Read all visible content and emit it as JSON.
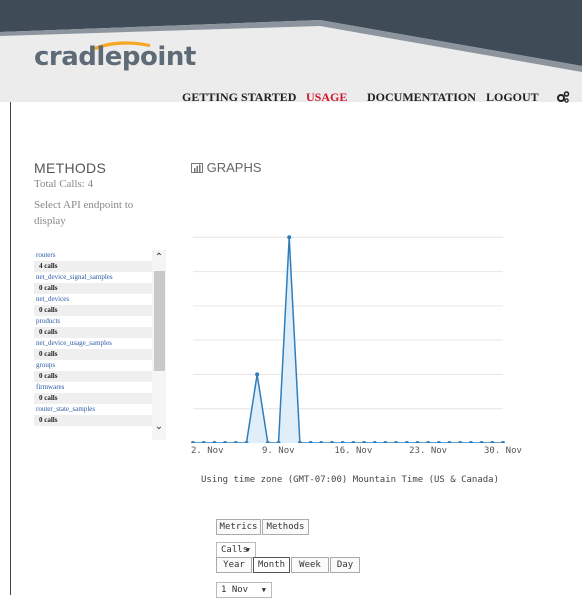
{
  "header": {
    "brand": "cradlepoint",
    "nav": [
      "GETTING STARTED",
      "USAGE",
      "DOCUMENTATION",
      "LOGOUT"
    ],
    "active_nav": "USAGE",
    "settings_icon": "gears-icon",
    "colors": {
      "dark": "#3f4c58",
      "light": "#ececec",
      "accent": "#d0172f",
      "swoosh": "#f5a623"
    }
  },
  "methods": {
    "title": "METHODS",
    "total_calls": "Total Calls: 4",
    "hint": "Select API endpoint to display",
    "items": [
      {
        "name": "routers",
        "calls": "4 calls"
      },
      {
        "name": "net_device_signal_samples",
        "calls": "0 calls"
      },
      {
        "name": "net_devices",
        "calls": "0 calls"
      },
      {
        "name": "products",
        "calls": "0 calls"
      },
      {
        "name": "net_device_usage_samples",
        "calls": "0 calls"
      },
      {
        "name": "groups",
        "calls": "0 calls"
      },
      {
        "name": "firmwares",
        "calls": "0 calls"
      },
      {
        "name": "router_state_samples",
        "calls": "0 calls"
      }
    ]
  },
  "graphs": {
    "title": "GRAPHS",
    "icon": "bar-chart-icon",
    "timezone_note": "Using time zone (GMT-07:00) Mountain Time (US & Canada)"
  },
  "chart_data": {
    "type": "area",
    "x": [
      1,
      2,
      3,
      4,
      5,
      6,
      7,
      8,
      9,
      10,
      11,
      12,
      13,
      14,
      15,
      16,
      17,
      18,
      19,
      20,
      21,
      22,
      23,
      24,
      25,
      26,
      27,
      28,
      29,
      30
    ],
    "values": [
      0,
      0,
      0,
      0,
      0,
      0,
      1,
      0,
      0,
      3,
      0,
      0,
      0,
      0,
      0,
      0,
      0,
      0,
      0,
      0,
      0,
      0,
      0,
      0,
      0,
      0,
      0,
      0,
      0,
      0
    ],
    "x_tick_labels": [
      "2. Nov",
      "9. Nov",
      "16. Nov",
      "23. Nov",
      "30. Nov"
    ],
    "x_tick_days": [
      2,
      9,
      16,
      23,
      30
    ],
    "ylim": [
      0,
      3.5
    ],
    "grid": true,
    "series_color": "#2f7ebc",
    "fill_color": "#dfeef9"
  },
  "controls": {
    "tabs": [
      "Metrics",
      "Methods"
    ],
    "metric_select": "Calls",
    "periods": [
      "Year",
      "Month",
      "Week",
      "Day"
    ],
    "selected_period": "Month",
    "date_select": "1 Nov"
  }
}
